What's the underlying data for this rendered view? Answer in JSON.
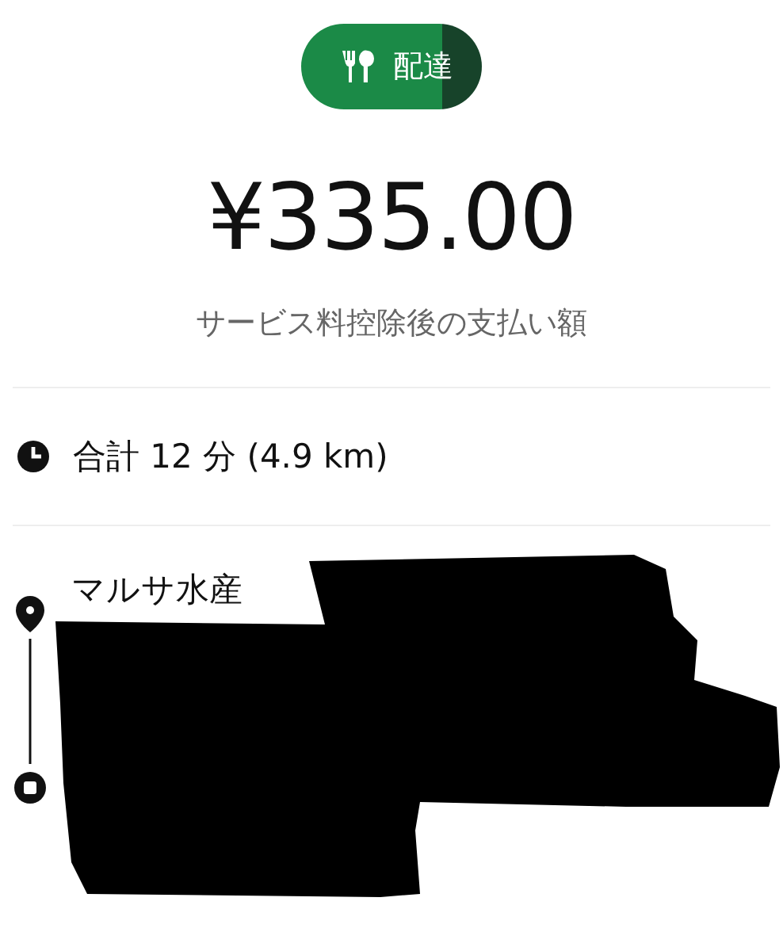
{
  "badge": {
    "label": "配達"
  },
  "fare": {
    "amount": "¥335.00",
    "caption": "サービス料控除後の支払い額"
  },
  "trip": {
    "summary": "合計 12 分 (4.9 km)"
  },
  "route": {
    "pickup": "マルサ水産"
  }
}
